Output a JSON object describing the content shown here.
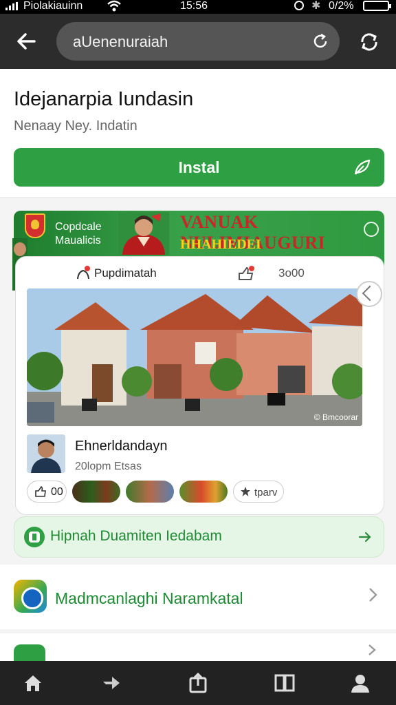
{
  "status_bar": {
    "carrier": "Piolakiauinn",
    "time": "15:56",
    "battery": "0/2%"
  },
  "toolbar": {
    "url": "aUenenuraiah"
  },
  "app": {
    "title": "Idejanarpia Iundasin",
    "subtitle": "Nenaay Ney. Indatin",
    "install_label": "Instal"
  },
  "banner": {
    "left_text": "Copdcale Maualicis",
    "headline": "VANUAK NULIMIAUGURI",
    "subheadline": "HHAHIEDEI"
  },
  "post": {
    "left_action": "Pupdimatah",
    "right_count": "3o00",
    "photo_credit": "© Bmcoorar",
    "author_name": "Ehnerldandayn",
    "author_meta": "20lopm Etsas",
    "like_count": "00",
    "share_label": "tparv"
  },
  "promo": {
    "label": "Hipnah Duamiten Iedabam"
  },
  "list": {
    "item1": "Madmcanlaghi Naramkatal"
  },
  "colors": {
    "accent_green": "#2ea043",
    "toolbar_bg": "#2c2c2c",
    "banner_red": "#c62828",
    "banner_yellow": "#f7d21e"
  },
  "icons": {
    "toolbar": [
      "arrow-left-icon",
      "reload-icon",
      "sync-icon"
    ],
    "nav": [
      "home-icon",
      "forward-icon",
      "share-icon",
      "book-icon",
      "profile-icon"
    ]
  }
}
